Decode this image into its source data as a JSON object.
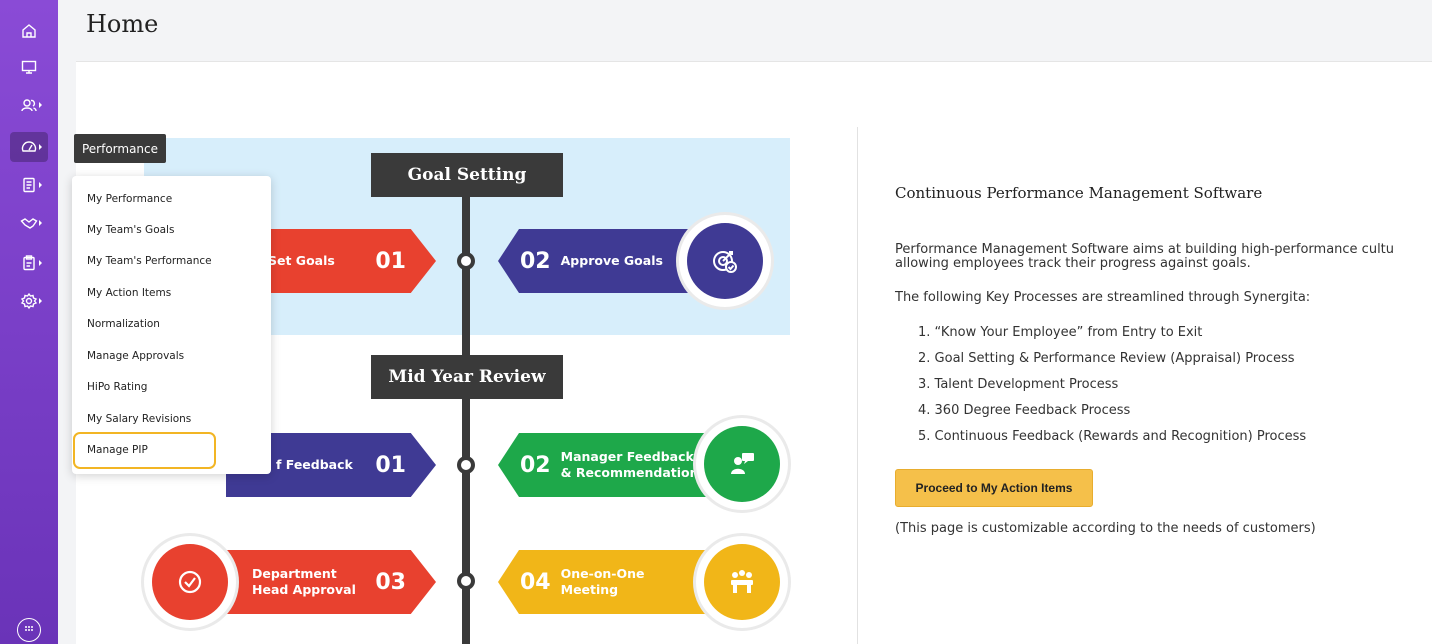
{
  "page": {
    "title": "Home"
  },
  "sidebar": {
    "items": [
      {
        "icon": "home-icon"
      },
      {
        "icon": "monitor-icon"
      },
      {
        "icon": "users-icon"
      },
      {
        "icon": "performance-gauge-icon",
        "active": true
      },
      {
        "icon": "document-icon"
      },
      {
        "icon": "handshake-icon"
      },
      {
        "icon": "clipboard-icon"
      },
      {
        "icon": "gear-icon"
      }
    ],
    "bottom_icon": "apps-grid-icon",
    "accent": "#7a3fc8"
  },
  "tooltip": {
    "label": "Performance"
  },
  "menu": {
    "items": [
      "My Performance",
      "My Team's Goals",
      "My Team's Performance",
      "My Action Items",
      "Normalization",
      "Manage Approvals",
      "HiPo Rating",
      "My Salary Revisions",
      "Manage PIP"
    ],
    "highlighted": "Manage PIP",
    "highlight_color": "#f2b524"
  },
  "infographic": {
    "stage1": "Goal Setting",
    "stage2": "Mid Year Review",
    "s1_left": {
      "label": "Set Goals",
      "num": "01",
      "color": "#e8412f"
    },
    "s1_right": {
      "label": "Approve Goals",
      "num": "02",
      "color": "#3f3a94"
    },
    "s2_left": {
      "label": "f Feedback",
      "num": "01",
      "color": "#3f3a94"
    },
    "s2_right": {
      "label_1": "Manager Feedback",
      "label_2": "& Recommendation",
      "num": "02",
      "color": "#1ea84a"
    },
    "s3_left": {
      "label_1": "Department",
      "label_2": "Head Approval",
      "num": "03",
      "color": "#e8412f"
    },
    "s3_right": {
      "label_1": "One-on-One",
      "label_2": "Meeting",
      "num": "04",
      "color": "#f1b618"
    }
  },
  "content": {
    "title": "Continuous Performance Management Software",
    "para1_line1": "Performance Management Software aims at building high-performance cultu",
    "para1_line2": "allowing employees track their progress against goals.",
    "para2": "The following Key Processes are streamlined through Synergita:",
    "list": [
      "1. “Know Your Employee” from Entry to Exit",
      "2. Goal Setting & Performance Review (Appraisal) Process",
      "3. Talent Development Process",
      "4. 360 Degree Feedback Process",
      "5. Continuous Feedback (Rewards and Recognition) Process"
    ],
    "button": "Proceed to My Action Items",
    "note": "(This page is customizable according to the needs of customers)"
  }
}
